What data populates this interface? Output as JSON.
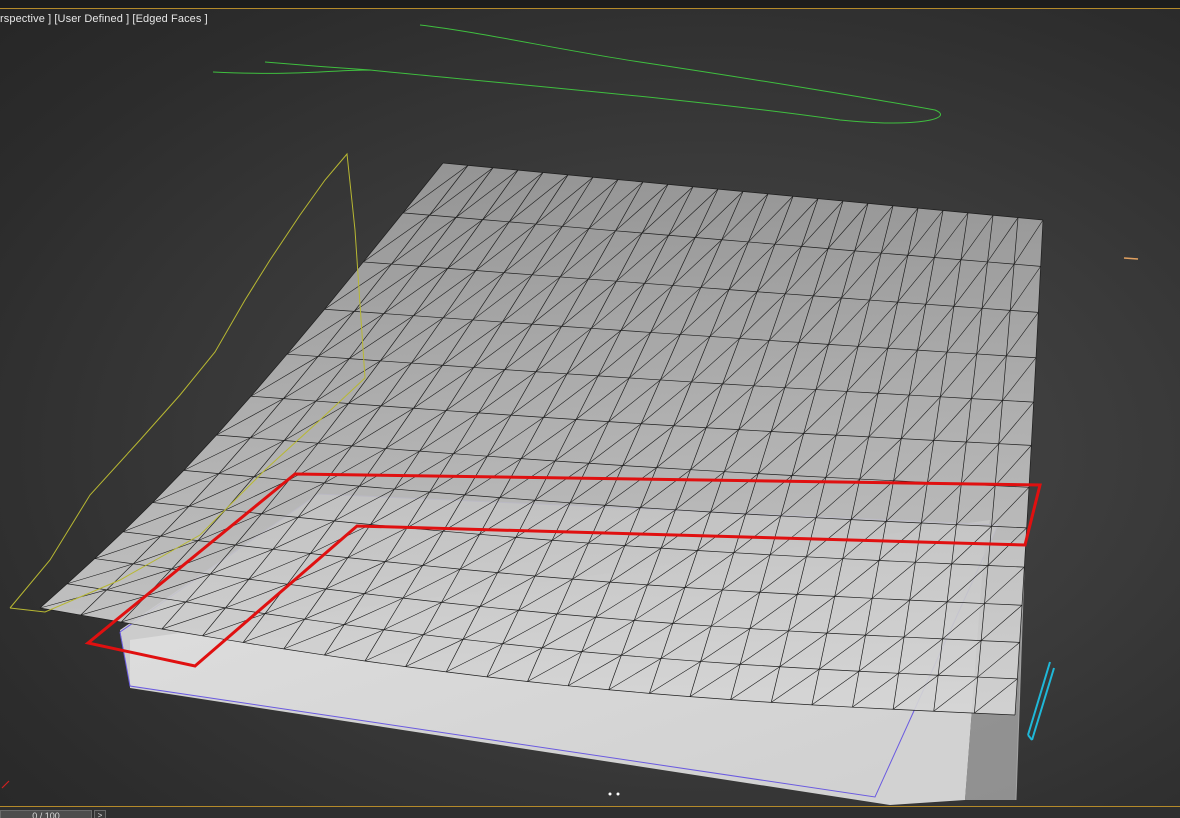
{
  "viewport": {
    "label_parts": [
      "rspective ]",
      "[User Defined ]",
      "[Edged Faces ]"
    ]
  },
  "timeline": {
    "frame_display": "0 / 100",
    "next_glyph": ">"
  },
  "colors": {
    "surface_fill": "#c8c8c8",
    "wire": "#1e1e1e",
    "selection_outline": "#e01010",
    "spline_green": "#3fbf3f",
    "spline_yellow": "#b8b832",
    "helper_cyan": "#1fb8d8",
    "bounding_box": "#6a5ae0",
    "accent_border": "#b48a2a"
  }
}
